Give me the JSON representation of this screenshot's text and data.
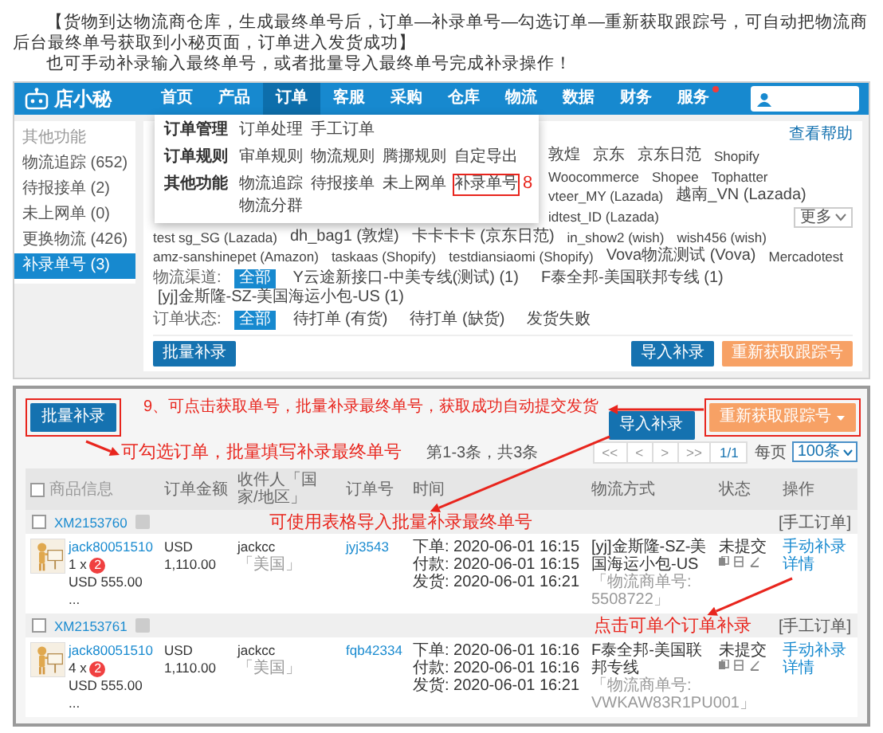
{
  "intro": [
    "【货物到达物流商仓库，生成最终单号后，订单—补录单号—勾选订单—重新获取跟踪号，可自动把物流商后台最终单号获取到小秘页面，订单进入发货成功】",
    "也可手动补录输入最终单号，或者批量导入最终单号完成补录操作！"
  ],
  "app": {
    "logo": "店小秘",
    "nav": [
      {
        "label": "首页",
        "selected": false,
        "notify": false
      },
      {
        "label": "产品",
        "selected": false,
        "notify": false
      },
      {
        "label": "订单",
        "selected": true,
        "notify": false
      },
      {
        "label": "客服",
        "selected": false,
        "notify": false
      },
      {
        "label": "采购",
        "selected": false,
        "notify": false
      },
      {
        "label": "仓库",
        "selected": false,
        "notify": false
      },
      {
        "label": "物流",
        "selected": false,
        "notify": false
      },
      {
        "label": "数据",
        "selected": false,
        "notify": false
      },
      {
        "label": "财务",
        "selected": false,
        "notify": false
      },
      {
        "label": "服务",
        "selected": false,
        "notify": true
      }
    ],
    "sidebar": {
      "heading": "其他功能",
      "items": [
        {
          "label": "物流追踪 (652)",
          "selected": false
        },
        {
          "label": "待报接单 (2)",
          "selected": false
        },
        {
          "label": "未上网单 (0)",
          "selected": false
        },
        {
          "label": "更换物流 (426)",
          "selected": false
        },
        {
          "label": "补录单号 (3)",
          "selected": true
        }
      ]
    },
    "menu": {
      "step": "8",
      "groups": [
        {
          "label": "订单管理",
          "items": [
            {
              "label": "订单处理",
              "highlighted": false
            },
            {
              "label": "手工订单",
              "highlighted": false
            }
          ]
        },
        {
          "label": "订单规则",
          "items": [
            {
              "label": "审单规则",
              "highlighted": false
            },
            {
              "label": "物流规则",
              "highlighted": false
            },
            {
              "label": "腾挪规则",
              "highlighted": false
            },
            {
              "label": "自定导出",
              "highlighted": false
            }
          ]
        },
        {
          "label": "其他功能",
          "items": [
            {
              "label": "物流追踪",
              "highlighted": false
            },
            {
              "label": "待报接单",
              "highlighted": false
            },
            {
              "label": "未上网单",
              "highlighted": false
            },
            {
              "label": "补录单号",
              "highlighted": true
            },
            {
              "label": "物流分群",
              "highlighted": false
            }
          ]
        }
      ]
    },
    "help_link": "查看帮助",
    "platforms": [
      "敦煌",
      "京东",
      "京东日范",
      "Shopify",
      "Woocommerce",
      "Shopee",
      "Tophatter"
    ],
    "shop_rows": [
      [
        "vteer_MY (Lazada)",
        "越南_VN (Lazada)",
        "idtest_ID (Lazada)"
      ],
      [
        "test sg_SG (Lazada)",
        "dh_bag1 (敦煌)",
        "卡卡卡卡 (京东日范)",
        "in_show2 (wish)",
        "wish456 (wish)"
      ],
      [
        "amz-sanshinepet (Amazon)",
        "taskaas (Shopify)",
        "testdiansiaomi (Shopify)",
        "Vova物流测试 (Vova)",
        "Mercadotest"
      ]
    ],
    "more_button": "更多",
    "filters": [
      {
        "label": "物流渠道:",
        "options": [
          {
            "label": "全部",
            "selected": true
          },
          {
            "label": "Y云途新接口-中美专线(测试) (1)",
            "selected": false
          },
          {
            "label": "F泰全邦-美国联邦专线 (1)",
            "selected": false
          },
          {
            "label": "[yj]金斯隆-SZ-美国海运小包-US (1)",
            "selected": false
          }
        ]
      },
      {
        "label": "订单状态:",
        "options": [
          {
            "label": "全部",
            "selected": true
          },
          {
            "label": "待打单 (有货)",
            "selected": false
          },
          {
            "label": "待打单 (缺货)",
            "selected": false
          },
          {
            "label": "发货失败",
            "selected": false
          }
        ]
      }
    ],
    "buttons": [
      {
        "label": "批量补录",
        "kind": "primary"
      },
      {
        "label": "导入补录",
        "kind": "primary"
      },
      {
        "label": "重新获取跟踪号",
        "kind": "warning"
      }
    ]
  },
  "list": {
    "bulk_button": "批量补录",
    "import_button": "导入补录",
    "refetch_button": "重新获取跟踪号",
    "notes": {
      "step9": "9、可点击获取单号，批量补录最终单号，获取成功自动提交发货",
      "select": "可勾选订单，批量填写补录最终单号",
      "import": "可使用表格导入批量补录最终单号",
      "single": "点击可单个订单补录"
    },
    "pager": {
      "summary": "第1-3条，共3条",
      "pages": [
        "<<",
        "<",
        ">",
        ">>",
        "1/1"
      ],
      "per_page_label": "每页",
      "per_page": "100条"
    },
    "select_all_checked": false,
    "columns": [
      "商品信息",
      "订单金额",
      "收件人「国家/地区」",
      "订单号",
      "时间",
      "物流方式",
      "状态",
      "操作"
    ],
    "orders": [
      {
        "id": "XM2153760",
        "checked": false,
        "tag": "[手工订单]",
        "product": "jack80051510",
        "qty": "1 x",
        "qty_badge": "2",
        "price": "USD 555.00",
        "more": "...",
        "amount": "USD 1,110.00",
        "recipient": "jackcc",
        "country": "「美国」",
        "order_no": "jyj3543",
        "times": [
          "下单: 2020-06-01 16:15",
          "付款: 2020-06-01 16:15",
          "发货: 2020-06-01 16:21"
        ],
        "shipping": "[yj]金斯隆-SZ-美国海运小包-US",
        "tracking": "「物流商单号: 5508722」",
        "status": "未提交",
        "actions": [
          "手动补录",
          "详情"
        ]
      },
      {
        "id": "XM2153761",
        "checked": false,
        "tag": "[手工订单]",
        "product": "jack80051510",
        "qty": "4 x",
        "qty_badge": "2",
        "price": "USD 555.00",
        "more": "...",
        "amount": "USD 1,110.00",
        "recipient": "jackcc",
        "country": "「美国」",
        "order_no": "fqb42334",
        "times": [
          "下单: 2020-06-01 16:16",
          "付款: 2020-06-01 16:16",
          "发货: 2020-06-01 16:21"
        ],
        "shipping": "F泰全邦-美国联邦专线",
        "tracking": "「物流商单号: VWKAW83R1PU001」",
        "status": "未提交",
        "actions": [
          "手动补录",
          "详情"
        ]
      }
    ]
  }
}
